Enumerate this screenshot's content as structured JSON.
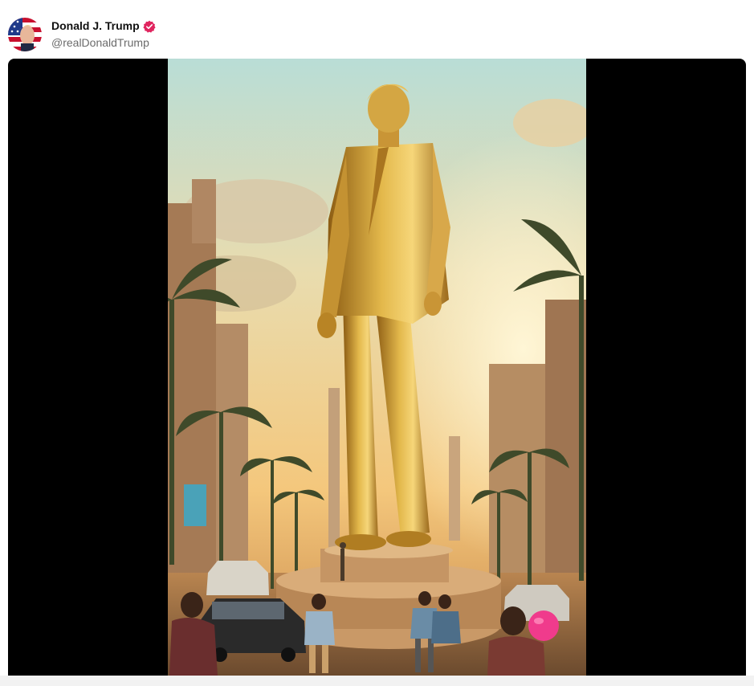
{
  "post": {
    "author_name": "Donald J. Trump",
    "author_handle": "@realDonaldTrump",
    "verified": true,
    "accent_color": "#e0245e"
  },
  "media": {
    "type": "video",
    "background_color": "#000000"
  },
  "icons": {
    "verified_badge": "verified-check-icon",
    "avatar": "avatar-flag-portrait"
  }
}
